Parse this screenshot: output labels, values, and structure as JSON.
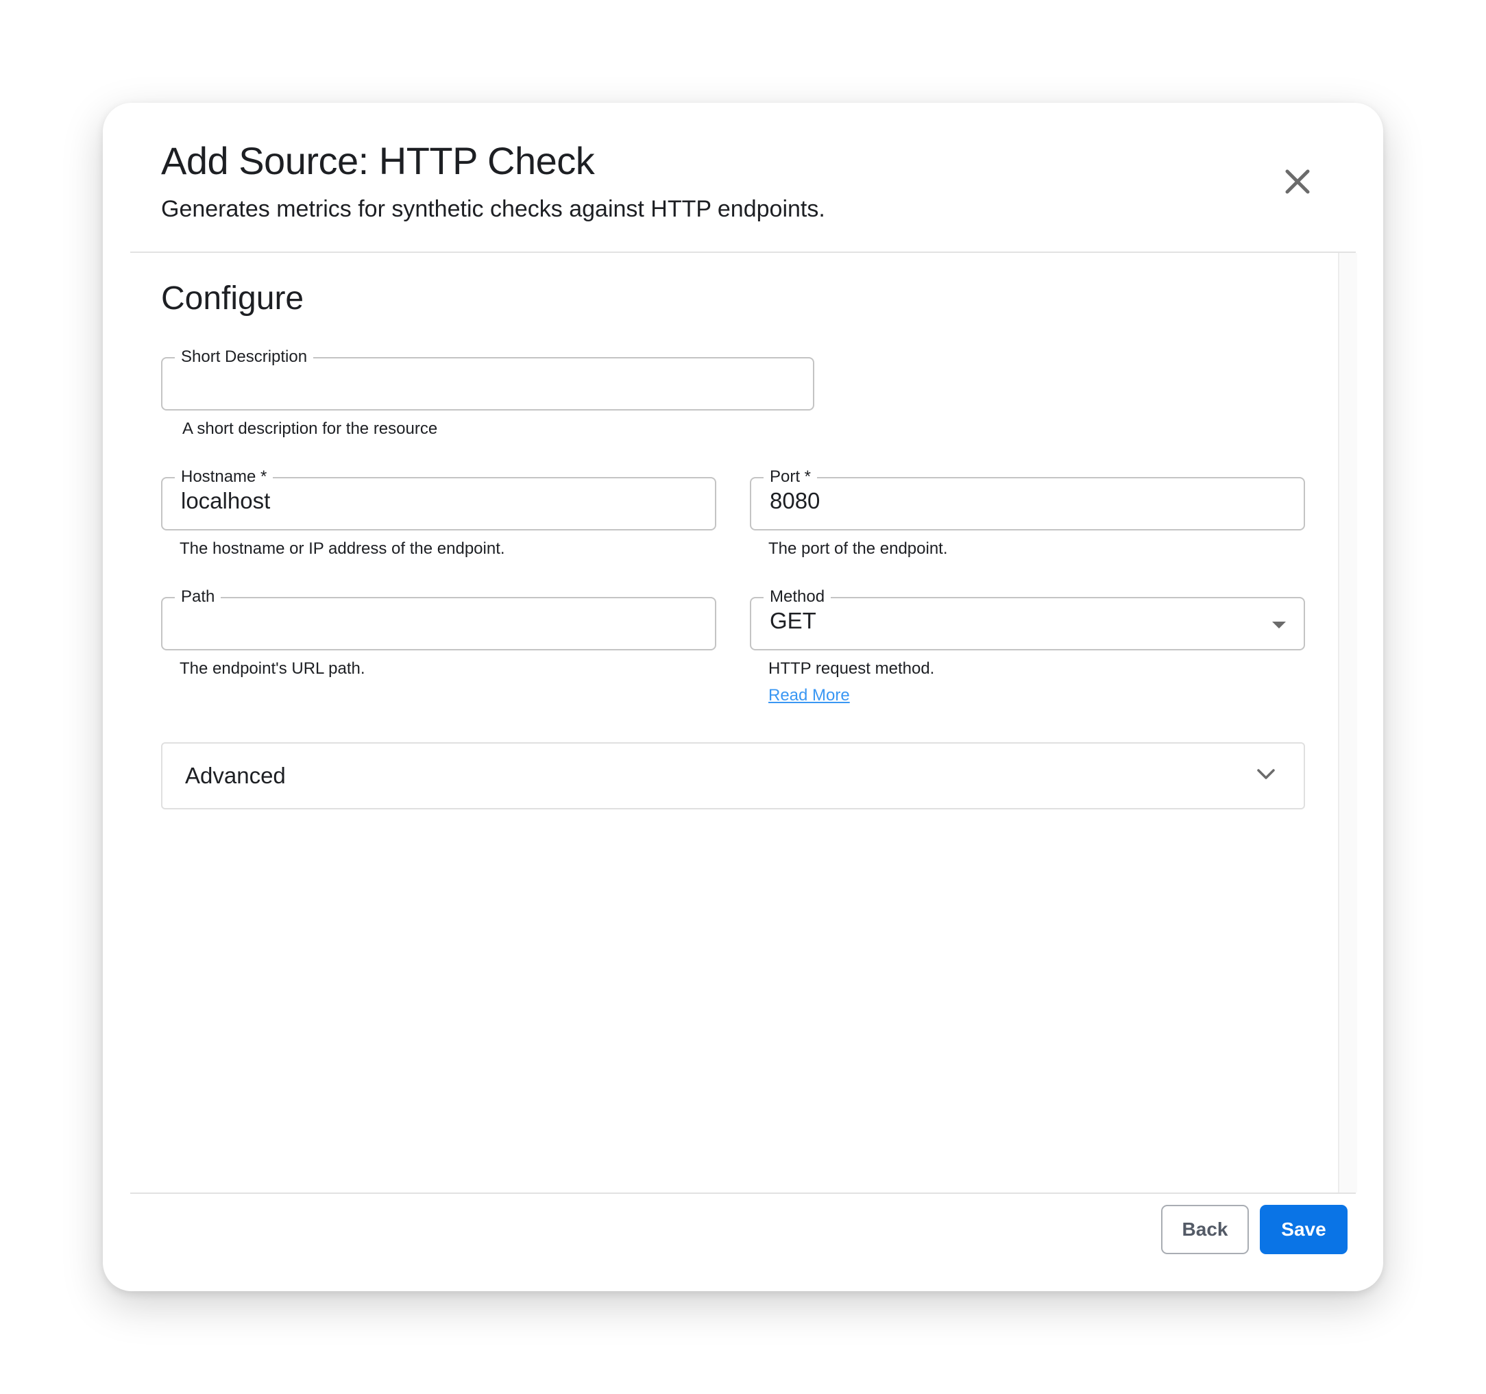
{
  "dialog": {
    "title": "Add Source: HTTP Check",
    "subtitle": "Generates metrics for synthetic checks against HTTP endpoints.",
    "close_icon": "close-icon"
  },
  "section": {
    "title": "Configure"
  },
  "fields": {
    "short_description": {
      "label": "Short Description",
      "value": "",
      "helper": "A short description for the resource"
    },
    "hostname": {
      "label": "Hostname *",
      "value": "localhost",
      "helper": "The hostname or IP address of the endpoint."
    },
    "port": {
      "label": "Port *",
      "value": "8080",
      "helper": "The port of the endpoint."
    },
    "path": {
      "label": "Path",
      "value": "",
      "helper": "The endpoint's URL path."
    },
    "method": {
      "label": "Method",
      "value": "GET",
      "helper": "HTTP request method.",
      "link": "Read More"
    }
  },
  "advanced": {
    "label": "Advanced",
    "icon": "chevron-down-icon"
  },
  "footer": {
    "back_label": "Back",
    "save_label": "Save"
  },
  "colors": {
    "primary": "#0a74e6",
    "link": "#3a97f3",
    "border": "#c4c4c4"
  }
}
